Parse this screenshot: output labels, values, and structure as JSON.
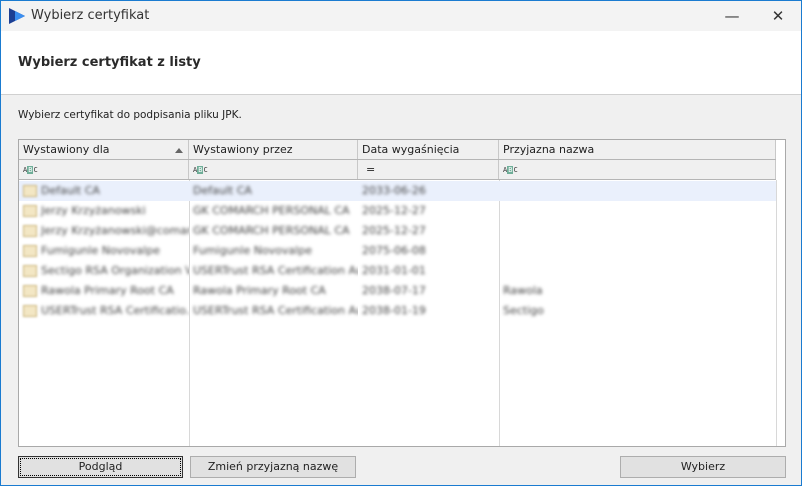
{
  "window": {
    "title": "Wybierz certyfikat",
    "minimize_icon": "minimize-icon",
    "close_icon": "close-icon"
  },
  "header": {
    "title": "Wybierz certyfikat z listy"
  },
  "description": "Wybierz certyfikat do podpisania pliku JPK.",
  "grid": {
    "columns": [
      "Wystawiony dla",
      "Wystawiony przez",
      "Data wygaśnięcia",
      "Przyjazna nazwa"
    ],
    "filters": [
      "ABC",
      "ABC",
      "=",
      "ABC"
    ],
    "rows": [
      [
        "Default CA",
        "Default CA",
        "2033-06-26",
        ""
      ],
      [
        "Jerzy Krzyżanowski",
        "GK COMARCH PERSONAL CA",
        "2025-12-27",
        ""
      ],
      [
        "Jerzy Krzyżanowski@comarch.pl",
        "GK COMARCH PERSONAL CA",
        "2025-12-27",
        ""
      ],
      [
        "Fumigunle Novovalpe",
        "Fumigunle Novovalpe",
        "2075-06-08",
        ""
      ],
      [
        "Sectigo RSA Organization V...",
        "USERTrust RSA Certification Au...",
        "2031-01-01",
        ""
      ],
      [
        "Rawola Primary Root CA",
        "Rawola Primary Root CA",
        "2038-07-17",
        "Rawola"
      ],
      [
        "USERTrust RSA Certificatio...",
        "USERTrust RSA Certification Au...",
        "2038-01-19",
        "Sectigo"
      ]
    ]
  },
  "buttons": {
    "preview": "Podgląd",
    "rename": "Zmień przyjazną nazwę",
    "select": "Wybierz"
  }
}
